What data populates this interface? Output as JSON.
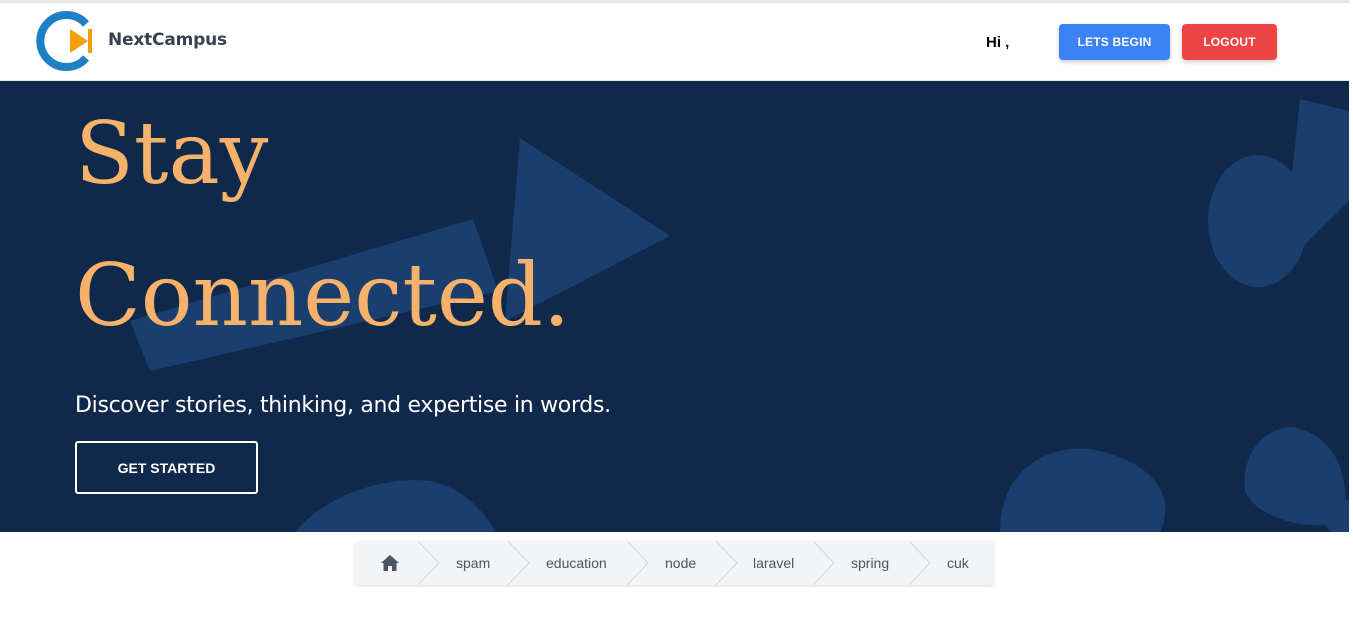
{
  "header": {
    "brand": "NextCampus",
    "greeting": "Hi ,",
    "lets_begin_label": "LETS BEGIN",
    "logout_label": "LOGOUT"
  },
  "hero": {
    "title_line1": "Stay",
    "title_line2": "Connected.",
    "subtitle": "Discover stories, thinking, and expertise in words.",
    "cta_label": "GET STARTED"
  },
  "breadcrumb": {
    "home_icon": "home-icon",
    "items": [
      "spam",
      "education",
      "node",
      "laravel",
      "spring",
      "cuk"
    ]
  },
  "colors": {
    "hero_bg": "#10294a",
    "hero_title": "#f6b26b",
    "begin_button": "#3b82f6",
    "logout_button": "#ef4444"
  }
}
